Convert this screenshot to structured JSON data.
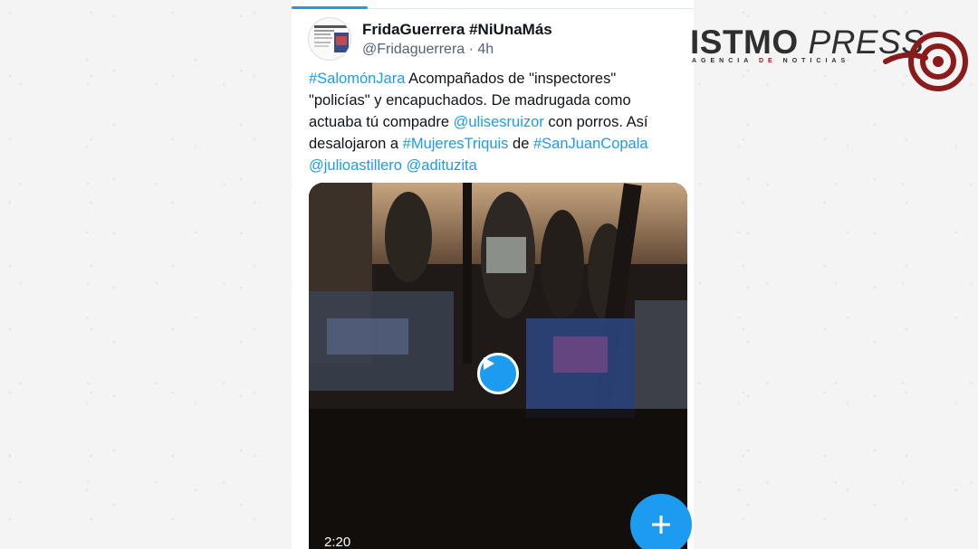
{
  "tweet": {
    "display_name": "FridaGuerrera #NiUnaMás",
    "handle": "@Fridaguerrera",
    "time": "4h",
    "text_segments": [
      {
        "text": "#SalomónJara",
        "link": true
      },
      {
        "text": " Acompañados de \"inspectores\" \"policías\" y encapuchados. De madrugada como actuaba tú compadre ",
        "link": false
      },
      {
        "text": "@ulisesruizor",
        "link": true
      },
      {
        "text": " con porros. Así desalojaron a ",
        "link": false
      },
      {
        "text": "#MujeresTriquis",
        "link": true
      },
      {
        "text": " de ",
        "link": false
      },
      {
        "text": "#SanJuanCopala",
        "link": true
      },
      {
        "text": " ",
        "link": false
      },
      {
        "text": "@julioastillero",
        "link": true
      },
      {
        "text": " ",
        "link": false
      },
      {
        "text": "@adituzita",
        "link": true
      }
    ],
    "video_duration": "2:20",
    "play_icon": "play-icon",
    "compose_icon": "plus-icon"
  },
  "logo": {
    "brand": "ISTMO",
    "brand_second": "PRESS",
    "tagline_left": "AGENCIA",
    "tagline_mid": "DE",
    "tagline_right": "NOTICIAS"
  },
  "colors": {
    "accent": "#1d9bf0",
    "text": "#0f1419",
    "muted": "#536471",
    "logo_red": "#8b1b1b"
  }
}
